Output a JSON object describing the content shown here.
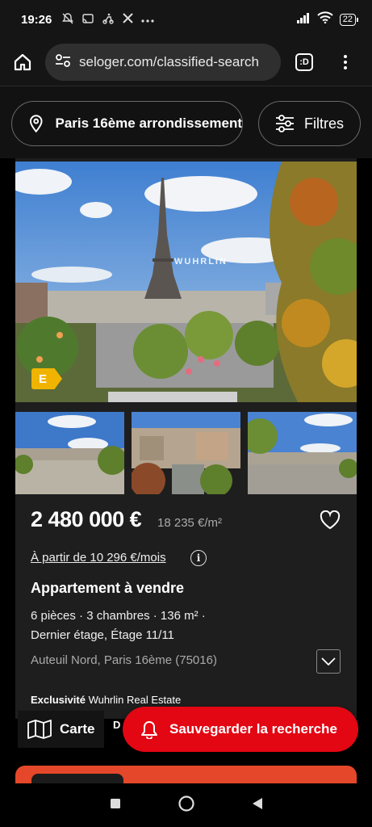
{
  "status_bar": {
    "time": "19:26",
    "battery": "22",
    "left_icons": [
      "mute-icon",
      "cast-icon",
      "scooter-icon",
      "x-icon",
      "more-icon"
    ]
  },
  "browser": {
    "url": "seloger.com/classified-search",
    "tab_label": ":D"
  },
  "search": {
    "location": "Paris 16ème arrondissement",
    "filters_label": "Filtres"
  },
  "listing": {
    "energy_class": "E",
    "watermark": "WUHRLIN",
    "price": "2 480 000 €",
    "price_per_m2": "18 235 €/m²",
    "monthly": "À partir de 10 296 €/mois",
    "info_glyph": "i",
    "property_type": "Appartement à vendre",
    "features": "6 pièces · 3 chambres · 136 m² ·",
    "floor": "Dernier étage, Étage 11/11",
    "address": "Auteuil Nord, Paris 16ème (75016)",
    "exclusive_label": "Exclusivité",
    "agency": "Wuhrlin Real Estate"
  },
  "bottom": {
    "map_label": "Carte",
    "partial_text": "D",
    "save_search_label": "Sauvegarder la recherche"
  },
  "colors": {
    "accent_red": "#e30613",
    "energy_badge": "#f0b400",
    "next_card": "#e5472a"
  }
}
